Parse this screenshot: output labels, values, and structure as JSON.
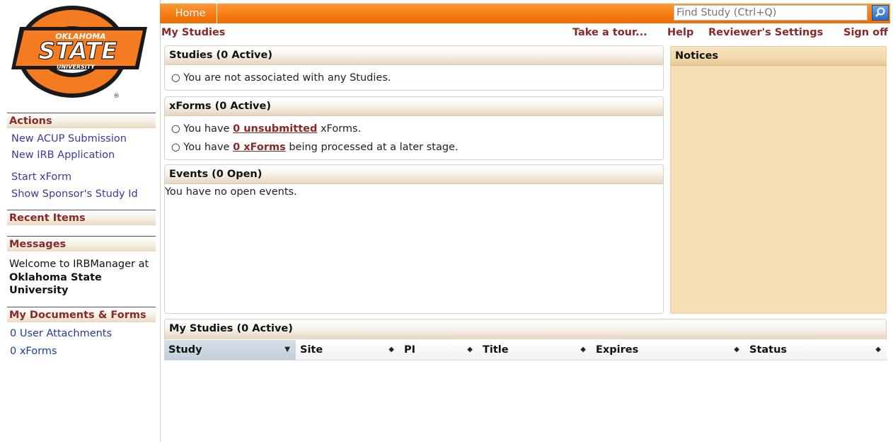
{
  "logo": {
    "line1": "OKLAHOMA",
    "line2": "STATE",
    "line3": "UNIVERSITY",
    "mark": "®"
  },
  "topbar": {
    "home_label": "Home",
    "search_placeholder": "Find Study (Ctrl+Q)",
    "search_icon": "search-icon"
  },
  "nav2": {
    "my_studies": "My Studies",
    "tour": "Take a tour...",
    "help": "Help",
    "reviewer_settings": "Reviewer's Settings",
    "sign_off": "Sign off"
  },
  "sidebar": {
    "actions_title": "Actions",
    "actions": [
      "New ACUP Submission",
      "New IRB Application",
      "Start xForm",
      "Show Sponsor's Study Id"
    ],
    "recent_title": "Recent Items",
    "messages_title": "Messages",
    "messages_text": {
      "part1": "Welcome to IRBManager at ",
      "bold": "Oklahoma State University"
    },
    "docs_title": "My Documents & Forms",
    "docs": [
      "0 User Attachments",
      "0 xForms"
    ]
  },
  "studies_panel": {
    "title": "Studies (0 Active)",
    "line": "You are not associated with any Studies."
  },
  "xforms_panel": {
    "title": "xForms (0 Active)",
    "line1": {
      "pre": "You have ",
      "link": "0 unsubmitted",
      "post": " xForms."
    },
    "line2": {
      "pre": "You have ",
      "link": "0 xForms",
      "post": " being processed at a later stage."
    }
  },
  "events_panel": {
    "title": "Events (0 Open)",
    "line": "You have no open events."
  },
  "notices": {
    "title": "Notices"
  },
  "my_studies_panel": {
    "title": "My Studies (0 Active)",
    "columns": [
      "Study",
      "Site",
      "PI",
      "Title",
      "Expires",
      "Status"
    ],
    "sort_icons": [
      "▼",
      "◆",
      "◆",
      "◆",
      "◆",
      "◆"
    ]
  },
  "colors": {
    "orange": "#f77c12",
    "maroon": "#8a2828",
    "notice_bg": "#f5deb3",
    "link_blue": "#3a3aa0"
  }
}
